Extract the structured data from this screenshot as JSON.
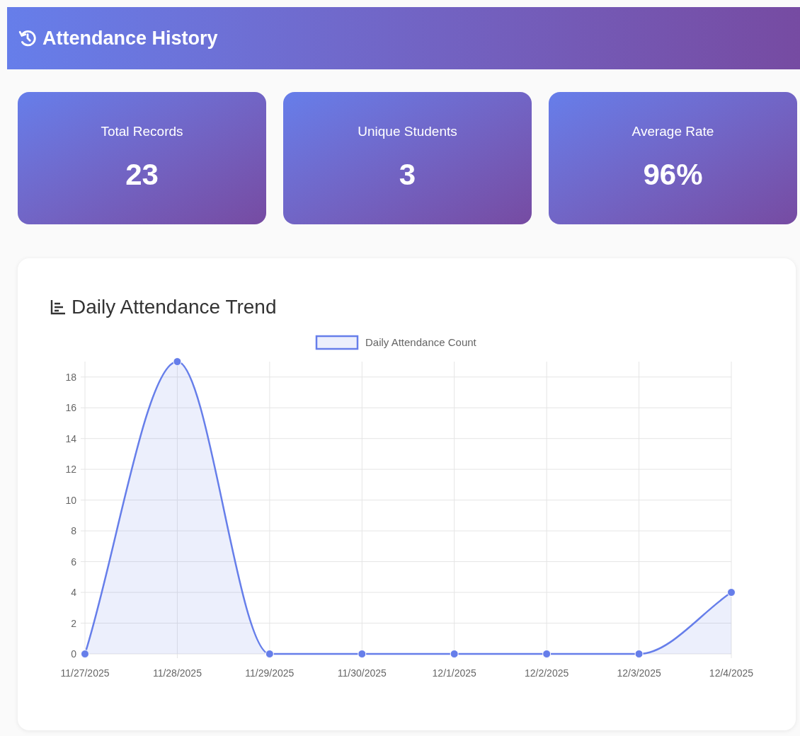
{
  "header": {
    "title": "Attendance History"
  },
  "stats": [
    {
      "label": "Total Records",
      "value": "23"
    },
    {
      "label": "Unique Students",
      "value": "3"
    },
    {
      "label": "Average Rate",
      "value": "96%"
    }
  ],
  "trend_card": {
    "title": "Daily Attendance Trend",
    "chart_data": {
      "type": "area",
      "categories": [
        "11/27/2025",
        "11/28/2025",
        "11/29/2025",
        "11/30/2025",
        "12/1/2025",
        "12/2/2025",
        "12/3/2025",
        "12/4/2025"
      ],
      "series": [
        {
          "name": "Daily Attendance Count",
          "color": "#667eea",
          "values": [
            0,
            19,
            0,
            0,
            0,
            0,
            0,
            4
          ]
        }
      ],
      "grid": true,
      "ylim": [
        0,
        19
      ],
      "yticks": [
        0,
        2,
        4,
        6,
        8,
        10,
        12,
        14,
        16,
        18
      ]
    }
  }
}
